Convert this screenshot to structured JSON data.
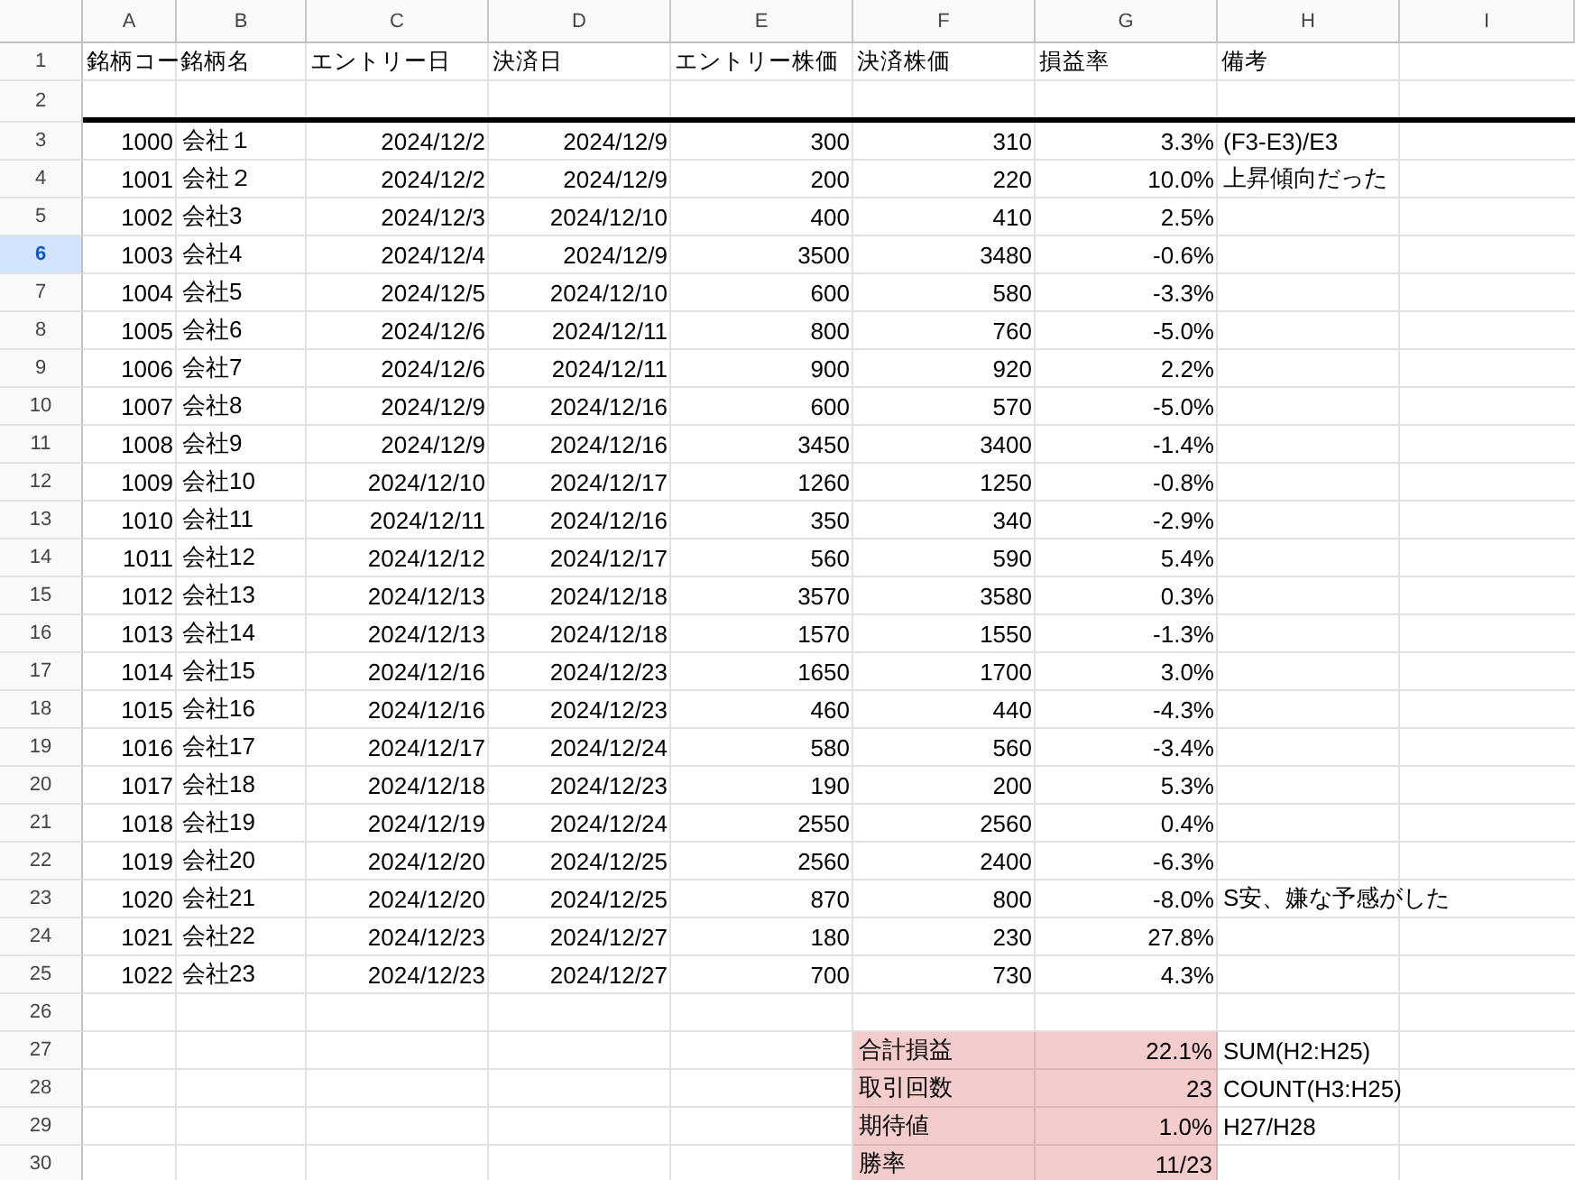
{
  "columns": [
    {
      "label": "A"
    },
    {
      "label": "B"
    },
    {
      "label": "C"
    },
    {
      "label": "D"
    },
    {
      "label": "E"
    },
    {
      "label": "F"
    },
    {
      "label": "G"
    },
    {
      "label": "H"
    },
    {
      "label": "I"
    }
  ],
  "rows": [
    {
      "number": "1",
      "kind": "header",
      "selected": false,
      "cells": [
        "銘柄コー",
        "銘柄名",
        "エントリー日",
        "決済日",
        "エントリー株価",
        "決済株価",
        "損益率",
        "備考"
      ]
    },
    {
      "number": "2",
      "kind": "divider",
      "selected": false,
      "cells": []
    },
    {
      "number": "3",
      "kind": "data",
      "selected": false,
      "cells": [
        "1000",
        "会社１",
        "2024/12/2",
        "2024/12/9",
        "300",
        "310",
        "3.3%",
        "(F3-E3)/E3"
      ]
    },
    {
      "number": "4",
      "kind": "data",
      "selected": false,
      "cells": [
        "1001",
        "会社２",
        "2024/12/2",
        "2024/12/9",
        "200",
        "220",
        "10.0%",
        "上昇傾向だった"
      ]
    },
    {
      "number": "5",
      "kind": "data",
      "selected": false,
      "cells": [
        "1002",
        "会社3",
        "2024/12/3",
        "2024/12/10",
        "400",
        "410",
        "2.5%"
      ]
    },
    {
      "number": "6",
      "kind": "data",
      "selected": true,
      "cells": [
        "1003",
        "会社4",
        "2024/12/4",
        "2024/12/9",
        "3500",
        "3480",
        "-0.6%"
      ]
    },
    {
      "number": "7",
      "kind": "data",
      "selected": false,
      "cells": [
        "1004",
        "会社5",
        "2024/12/5",
        "2024/12/10",
        "600",
        "580",
        "-3.3%"
      ]
    },
    {
      "number": "8",
      "kind": "data",
      "selected": false,
      "cells": [
        "1005",
        "会社6",
        "2024/12/6",
        "2024/12/11",
        "800",
        "760",
        "-5.0%"
      ]
    },
    {
      "number": "9",
      "kind": "data",
      "selected": false,
      "cells": [
        "1006",
        "会社7",
        "2024/12/6",
        "2024/12/11",
        "900",
        "920",
        "2.2%"
      ]
    },
    {
      "number": "10",
      "kind": "data",
      "selected": false,
      "cells": [
        "1007",
        "会社8",
        "2024/12/9",
        "2024/12/16",
        "600",
        "570",
        "-5.0%"
      ]
    },
    {
      "number": "11",
      "kind": "data",
      "selected": false,
      "cells": [
        "1008",
        "会社9",
        "2024/12/9",
        "2024/12/16",
        "3450",
        "3400",
        "-1.4%"
      ]
    },
    {
      "number": "12",
      "kind": "data",
      "selected": false,
      "cells": [
        "1009",
        "会社10",
        "2024/12/10",
        "2024/12/17",
        "1260",
        "1250",
        "-0.8%"
      ]
    },
    {
      "number": "13",
      "kind": "data",
      "selected": false,
      "cells": [
        "1010",
        "会社11",
        "2024/12/11",
        "2024/12/16",
        "350",
        "340",
        "-2.9%"
      ]
    },
    {
      "number": "14",
      "kind": "data",
      "selected": false,
      "cells": [
        "1011",
        "会社12",
        "2024/12/12",
        "2024/12/17",
        "560",
        "590",
        "5.4%"
      ]
    },
    {
      "number": "15",
      "kind": "data",
      "selected": false,
      "cells": [
        "1012",
        "会社13",
        "2024/12/13",
        "2024/12/18",
        "3570",
        "3580",
        "0.3%"
      ]
    },
    {
      "number": "16",
      "kind": "data",
      "selected": false,
      "cells": [
        "1013",
        "会社14",
        "2024/12/13",
        "2024/12/18",
        "1570",
        "1550",
        "-1.3%"
      ]
    },
    {
      "number": "17",
      "kind": "data",
      "selected": false,
      "cells": [
        "1014",
        "会社15",
        "2024/12/16",
        "2024/12/23",
        "1650",
        "1700",
        "3.0%"
      ]
    },
    {
      "number": "18",
      "kind": "data",
      "selected": false,
      "cells": [
        "1015",
        "会社16",
        "2024/12/16",
        "2024/12/23",
        "460",
        "440",
        "-4.3%"
      ]
    },
    {
      "number": "19",
      "kind": "data",
      "selected": false,
      "cells": [
        "1016",
        "会社17",
        "2024/12/17",
        "2024/12/24",
        "580",
        "560",
        "-3.4%"
      ]
    },
    {
      "number": "20",
      "kind": "data",
      "selected": false,
      "cells": [
        "1017",
        "会社18",
        "2024/12/18",
        "2024/12/23",
        "190",
        "200",
        "5.3%"
      ]
    },
    {
      "number": "21",
      "kind": "data",
      "selected": false,
      "cells": [
        "1018",
        "会社19",
        "2024/12/19",
        "2024/12/24",
        "2550",
        "2560",
        "0.4%"
      ]
    },
    {
      "number": "22",
      "kind": "data",
      "selected": false,
      "cells": [
        "1019",
        "会社20",
        "2024/12/20",
        "2024/12/25",
        "2560",
        "2400",
        "-6.3%"
      ]
    },
    {
      "number": "23",
      "kind": "data",
      "selected": false,
      "cells": [
        "1020",
        "会社21",
        "2024/12/20",
        "2024/12/25",
        "870",
        "800",
        "-8.0%",
        "S安、嫌な予感がした"
      ]
    },
    {
      "number": "24",
      "kind": "data",
      "selected": false,
      "cells": [
        "1021",
        "会社22",
        "2024/12/23",
        "2024/12/27",
        "180",
        "230",
        "27.8%"
      ]
    },
    {
      "number": "25",
      "kind": "data",
      "selected": false,
      "cells": [
        "1022",
        "会社23",
        "2024/12/23",
        "2024/12/27",
        "700",
        "730",
        "4.3%"
      ]
    },
    {
      "number": "26",
      "kind": "blank",
      "selected": false,
      "cells": []
    },
    {
      "number": "27",
      "kind": "summary",
      "selected": false,
      "cells": [
        "合計損益",
        "22.1%",
        "SUM(H2:H25)"
      ]
    },
    {
      "number": "28",
      "kind": "summary",
      "selected": false,
      "cells": [
        "取引回数",
        "23",
        "COUNT(H3:H25)"
      ]
    },
    {
      "number": "29",
      "kind": "summary",
      "selected": false,
      "cells": [
        "期待値",
        "1.0%",
        "H27/H28"
      ]
    },
    {
      "number": "30",
      "kind": "summary",
      "selected": false,
      "cells": [
        "勝率",
        "11/23"
      ]
    }
  ]
}
